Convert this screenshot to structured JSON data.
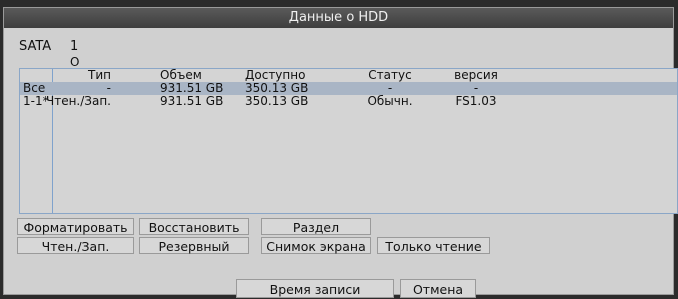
{
  "window": {
    "title": "Данные о HDD"
  },
  "sata": {
    "label": "SATA",
    "number": "1",
    "port": "O"
  },
  "table": {
    "headers": {
      "type": "Тип",
      "size": "Объем",
      "avail": "Доступно",
      "status": "Статус",
      "version": "версия"
    },
    "rows": [
      {
        "id": "Все",
        "type": "-",
        "size": "931.51 GB",
        "avail": "350.13 GB",
        "status": "-",
        "version": "-",
        "selected": true
      },
      {
        "id": "1-1*",
        "type": "Чтен./Зап.",
        "size": "931.51 GB",
        "avail": "350.13 GB",
        "status": "Обычн.",
        "version": "FS1.03",
        "selected": false
      }
    ]
  },
  "buttons": {
    "format": "Форматировать",
    "restore": "Восстановить",
    "partition": "Раздел",
    "read_write": "Чтен./Зап.",
    "backup": "Резервный",
    "snapshot": "Снимок экрана",
    "read_only": "Только чтение",
    "record_time": "Время записи",
    "cancel": "Отмена"
  },
  "colors": {
    "selected_row": "#a9b5c5",
    "panel": "#d0d0d0",
    "titlebar": "#4a4a4a"
  }
}
